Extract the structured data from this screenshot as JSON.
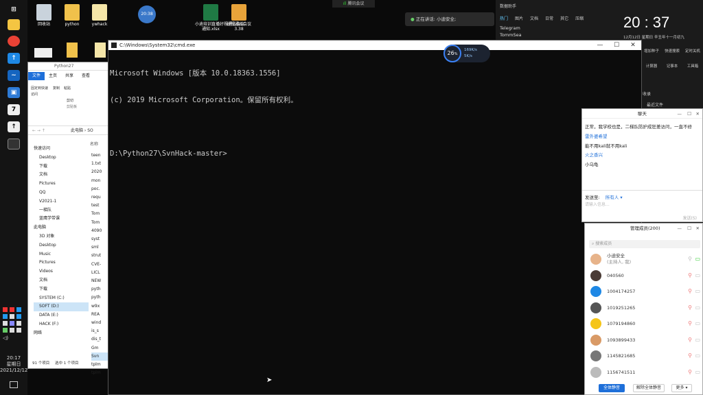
{
  "desktop_icons": [
    {
      "label": "回收站"
    },
    {
      "label": "python"
    },
    {
      "label": "ywhack"
    },
    {
      "label": "小迪培训直播好视通云会议\n通知.xlsx"
    },
    {
      "label": "好视通云会议\n3.38"
    }
  ],
  "clock_widget": {
    "value": "20:38"
  },
  "meeting_top": {
    "label": "腾讯会议"
  },
  "speaking_bar": {
    "text": "正在讲话: 小迪安全;"
  },
  "network_widget": {
    "percent": "26",
    "unit": "%",
    "up": "169K/s",
    "down": "5K/s"
  },
  "taskbar": {
    "time": "20:17",
    "weekday": "星期日",
    "date": "2021/12/12"
  },
  "cmd": {
    "title": "C:\\Windows\\System32\\cmd.exe",
    "lines": [
      "Microsoft Windows [版本 10.0.18363.1556]",
      "(c) 2019 Microsoft Corporation。保留所有权利。",
      "",
      "D:\\Python27\\SvnHack-master>"
    ]
  },
  "explorer": {
    "path": "Python27",
    "tabs": [
      "文件",
      "主页",
      "共享",
      "查看"
    ],
    "ribbon": [
      "固定到快速访问",
      "复制",
      "粘贴",
      "剪切"
    ],
    "clipboard_label": "剪贴板",
    "breadcrumb": "此电脑 › SO",
    "col_header": "名称",
    "nav": [
      "快速访问",
      "Desktop",
      "下载",
      "文档",
      "Pictures",
      "QQ",
      "V2021-1",
      "一梯队",
      "蓝鹰学带课",
      "此电脑",
      "3D 对象",
      "Desktop",
      "Music",
      "Pictures",
      "Videos",
      "文档",
      "下载",
      "SYSTEM (C:)",
      "SOFT (D:)",
      "DATA (E:)",
      "HACK (F:)",
      "网络"
    ],
    "files": [
      "teen",
      "1.txt",
      "2020",
      "mon",
      "poc.",
      "requ",
      "test",
      "Tom",
      "Tom",
      "4090",
      "syst",
      "sml",
      "strut",
      "CVE-",
      "LICL",
      "NEW",
      "pyth",
      "pyth",
      "w9x",
      "REA",
      "wind",
      "is_s",
      "dis_t",
      "Gm",
      "Svn",
      "tplm",
      "tplm"
    ],
    "status_count": "91 个项目",
    "status_selected": "选中 1 个项目"
  },
  "right_panel": {
    "title": "数据助手",
    "tabs": [
      "热门",
      "图片",
      "文档",
      "日常",
      "其它",
      "压缩"
    ],
    "items": [
      "Telegram",
      "TommSea"
    ],
    "time": "20 : 37",
    "date_line": "12月12日  星期日  辛丑年十一月初九",
    "tools": [
      "增加种子",
      "快速搜索",
      "定时关机",
      "计算器",
      "记事本",
      "工具箱"
    ],
    "section": "收录",
    "recent": "最近文件"
  },
  "chat": {
    "title": "聊天",
    "messages": [
      {
        "text": "正常，我学校也是，二梯队防护成狂差访问，一直不修",
        "type": "msg"
      },
      {
        "text": "雷外婆希望",
        "type": "name"
      },
      {
        "text": "能不用kali就不用kali",
        "type": "msg"
      },
      {
        "text": "火之香兴",
        "type": "name"
      },
      {
        "text": "小乌龟",
        "type": "msg"
      }
    ],
    "send_to_label": "发送至:",
    "send_to_value": "所有人",
    "input_placeholder": "请输入信息...",
    "send_label": "发送(S)"
  },
  "members": {
    "title": "管理成员(200)",
    "search_placeholder": "搜索成员",
    "list": [
      {
        "name": "小迪安全",
        "sub": "(主持人, 我)",
        "color": "#e7b38a"
      },
      {
        "name": "040560",
        "sub": "",
        "color": "#4a3b35"
      },
      {
        "name": "1004174257",
        "sub": "",
        "color": "#1e88e5"
      },
      {
        "name": "1019251265",
        "sub": "",
        "color": "#555"
      },
      {
        "name": "1079194860",
        "sub": "",
        "color": "#f5c518"
      },
      {
        "name": "1093899433",
        "sub": "",
        "color": "#d99a66"
      },
      {
        "name": "1145821685",
        "sub": "",
        "color": "#777"
      },
      {
        "name": "1156741511",
        "sub": "",
        "color": "#bbb"
      }
    ],
    "btn_mute_all": "全体静音",
    "btn_unmute_all": "解除全体静音",
    "btn_more": "更多"
  }
}
